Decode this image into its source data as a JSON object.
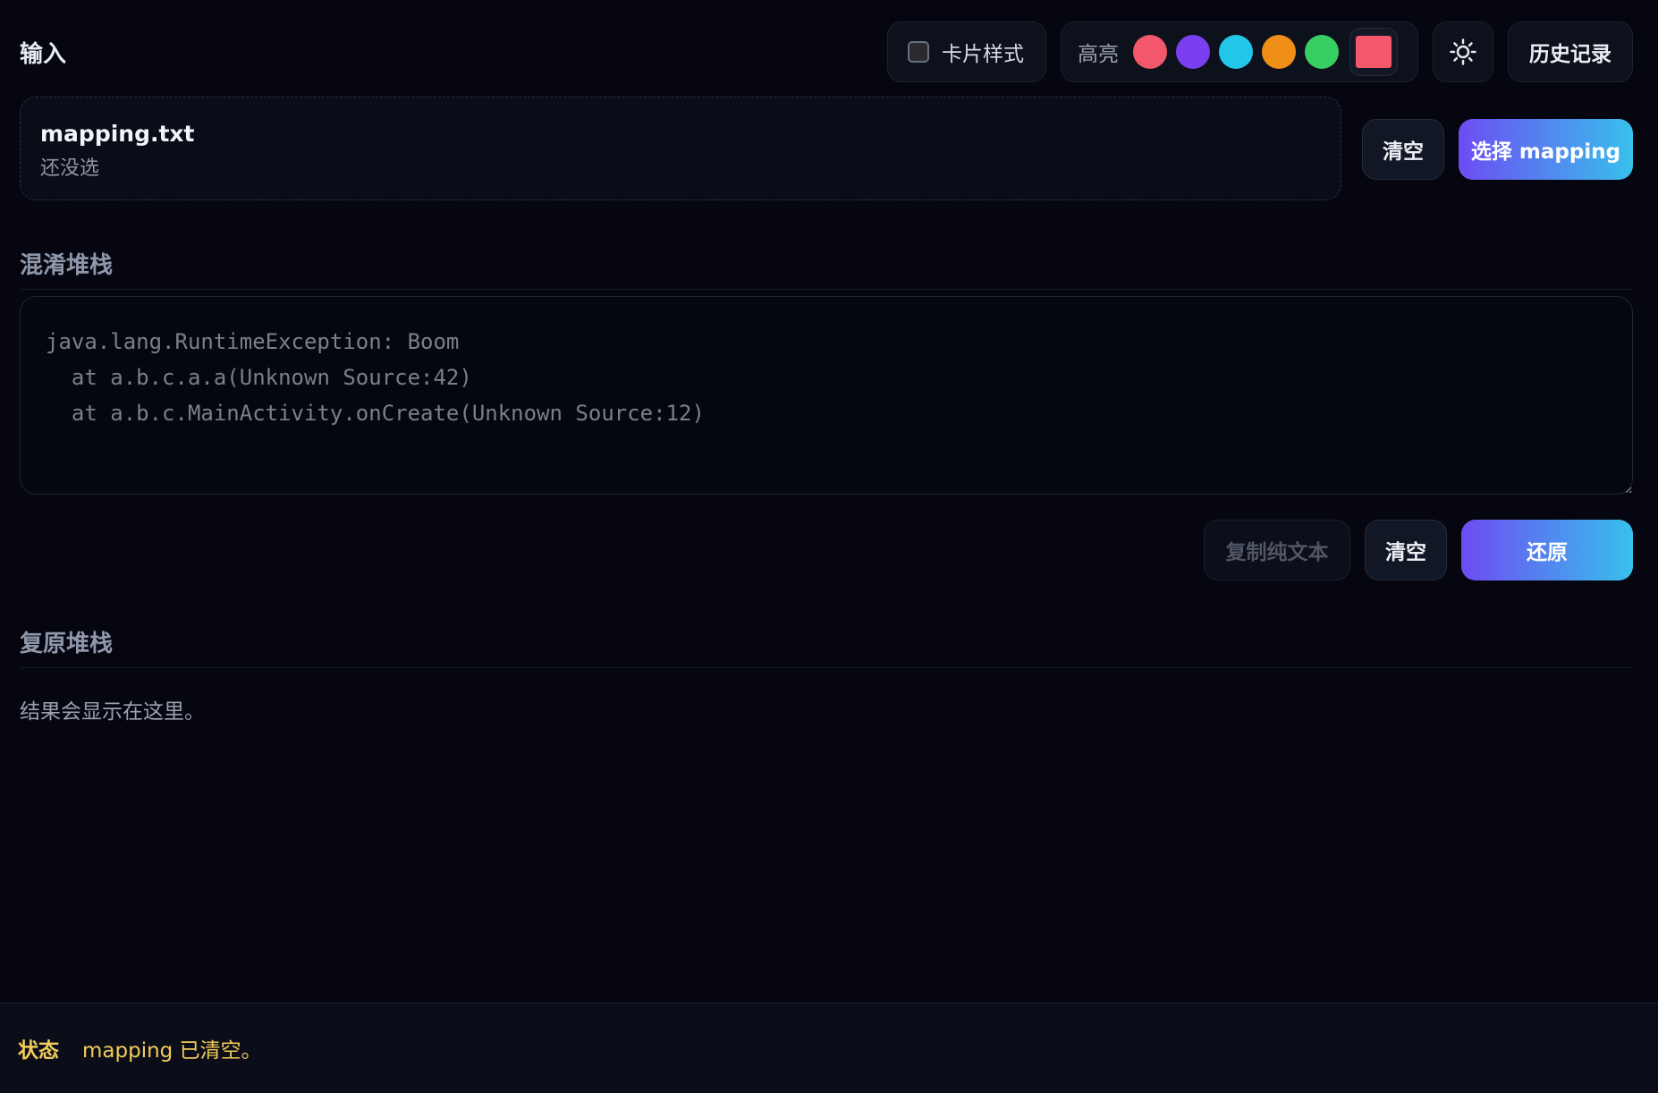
{
  "header": {
    "section_label": "输入",
    "card_toggle_label": "卡片样式",
    "card_toggle_checked": false,
    "highlight_label": "高亮",
    "highlight_swatches": [
      "#f2576b",
      "#7b3ef0",
      "#22c6e8",
      "#f08f17",
      "#37cf62"
    ],
    "custom_color": "#f2576b",
    "theme_icon": "sun-icon",
    "history_label": "历史记录"
  },
  "mapping": {
    "file_name": "mapping.txt",
    "file_status": "还没选",
    "clear_label": "清空",
    "select_label": "选择 mapping"
  },
  "obfuscated": {
    "heading": "混淆堆栈",
    "placeholder": "java.lang.RuntimeException: Boom\n  at a.b.c.a.a(Unknown Source:42)\n  at a.b.c.MainActivity.onCreate(Unknown Source:12)",
    "value": "",
    "copy_label": "复制纯文本",
    "clear_label": "清空",
    "restore_label": "还原"
  },
  "restored": {
    "heading": "复原堆栈",
    "result_text": "结果会显示在这里。"
  },
  "status": {
    "label": "状态",
    "message": "mapping 已清空。"
  },
  "colors": {
    "accent_start": "#6d4cf2",
    "accent_end": "#38c0ec",
    "status_text": "#f1cc5a",
    "background": "#05060f"
  }
}
